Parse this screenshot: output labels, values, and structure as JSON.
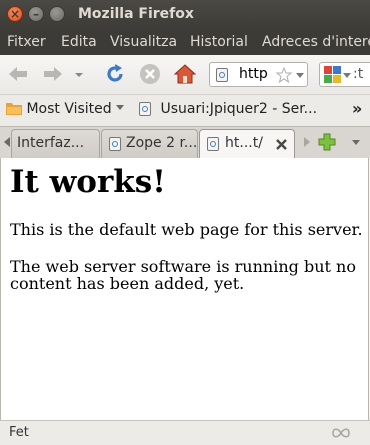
{
  "window": {
    "title": "Mozilla Firefox"
  },
  "menu": [
    "Fitxer",
    "Edita",
    "Visualitza",
    "Historial",
    "Adreces d'intere"
  ],
  "url": {
    "text": "http"
  },
  "search": {
    "text": ":t"
  },
  "bookmarks": {
    "most_visited": "Most Visited",
    "item1": "Usuari:Jpiquer2 - Ser...",
    "overflow": "»"
  },
  "tabs": [
    "Interfaz...",
    "Zope 2 r...",
    "ht...t/"
  ],
  "page": {
    "heading": "It works!",
    "p1": "This is the default web page for this server.",
    "p2": "The web server software is running but no content has been added, yet."
  },
  "status": {
    "text": "Fet"
  }
}
